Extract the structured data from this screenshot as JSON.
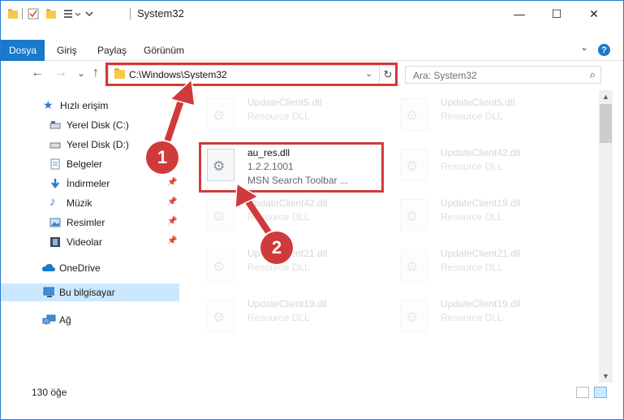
{
  "window": {
    "title": "System32",
    "controls": {
      "minimize": "—",
      "maximize": "☐",
      "close": "✕"
    }
  },
  "ribbon": {
    "file_tab": "Dosya",
    "tabs": [
      "Giriş",
      "Paylaş",
      "Görünüm"
    ],
    "expand": "⌄",
    "help": "?"
  },
  "address": {
    "path": "C:\\Windows\\System32",
    "dropdown": "⌄",
    "refresh": "↻"
  },
  "search": {
    "placeholder": "Ara: System32",
    "icon": "⌕"
  },
  "nav_glyphs": {
    "back": "←",
    "forward": "→",
    "recent": "⌄",
    "up": "↑"
  },
  "sidebar": {
    "items": [
      {
        "label": "Hızlı erişim",
        "icon": "star-icon",
        "pinned": false
      },
      {
        "label": "Yerel Disk (C:)",
        "icon": "drive-icon",
        "pinned": true
      },
      {
        "label": "Yerel Disk (D:)",
        "icon": "drive-icon",
        "pinned": true
      },
      {
        "label": "Belgeler",
        "icon": "documents-icon",
        "pinned": true
      },
      {
        "label": "İndirmeler",
        "icon": "download-icon",
        "pinned": true
      },
      {
        "label": "Müzik",
        "icon": "music-icon",
        "pinned": true
      },
      {
        "label": "Resimler",
        "icon": "pictures-icon",
        "pinned": true
      },
      {
        "label": "Videolar",
        "icon": "videos-icon",
        "pinned": true
      },
      {
        "label": "OneDrive",
        "icon": "cloud-icon",
        "pinned": false
      },
      {
        "label": "Bu bilgisayar",
        "icon": "computer-icon",
        "pinned": false,
        "selected": true
      },
      {
        "label": "Ağ",
        "icon": "network-icon",
        "pinned": false
      }
    ],
    "pin_glyph": "📌"
  },
  "files": {
    "highlighted": {
      "name": "au_res.dll",
      "version": "1.2.2.1001",
      "description": "MSN Search Toolbar ..."
    },
    "background": [
      {
        "name": "UpdateClient5.dll",
        "description": "Resource DLL"
      },
      {
        "name": "UpdateClient5.dll",
        "description": "Resource DLL"
      },
      {
        "name": "UpdateClient42.dll",
        "description": "Resource DLL"
      },
      {
        "name": "UpdateClient42.dll",
        "description": "Resource DLL"
      },
      {
        "name": "UpdateClient19.dll",
        "description": "Resource DLL"
      },
      {
        "name": "UpdateClient21.dll",
        "description": "Resource DLL"
      },
      {
        "name": "UpdateClient21.dll",
        "description": "Resource DLL"
      },
      {
        "name": "UpdateClient19.dll",
        "description": "Resource DLL"
      },
      {
        "name": "UpdateClient19.dll",
        "description": "Resource DLL"
      }
    ]
  },
  "status": {
    "count": "130 öğe"
  },
  "annotations": {
    "step1": "1",
    "step2": "2",
    "accent": "#d13a3a"
  },
  "colors": {
    "file_tab": "#1979ca",
    "selection": "#cce8ff",
    "highlight_border": "#d13a3a"
  }
}
